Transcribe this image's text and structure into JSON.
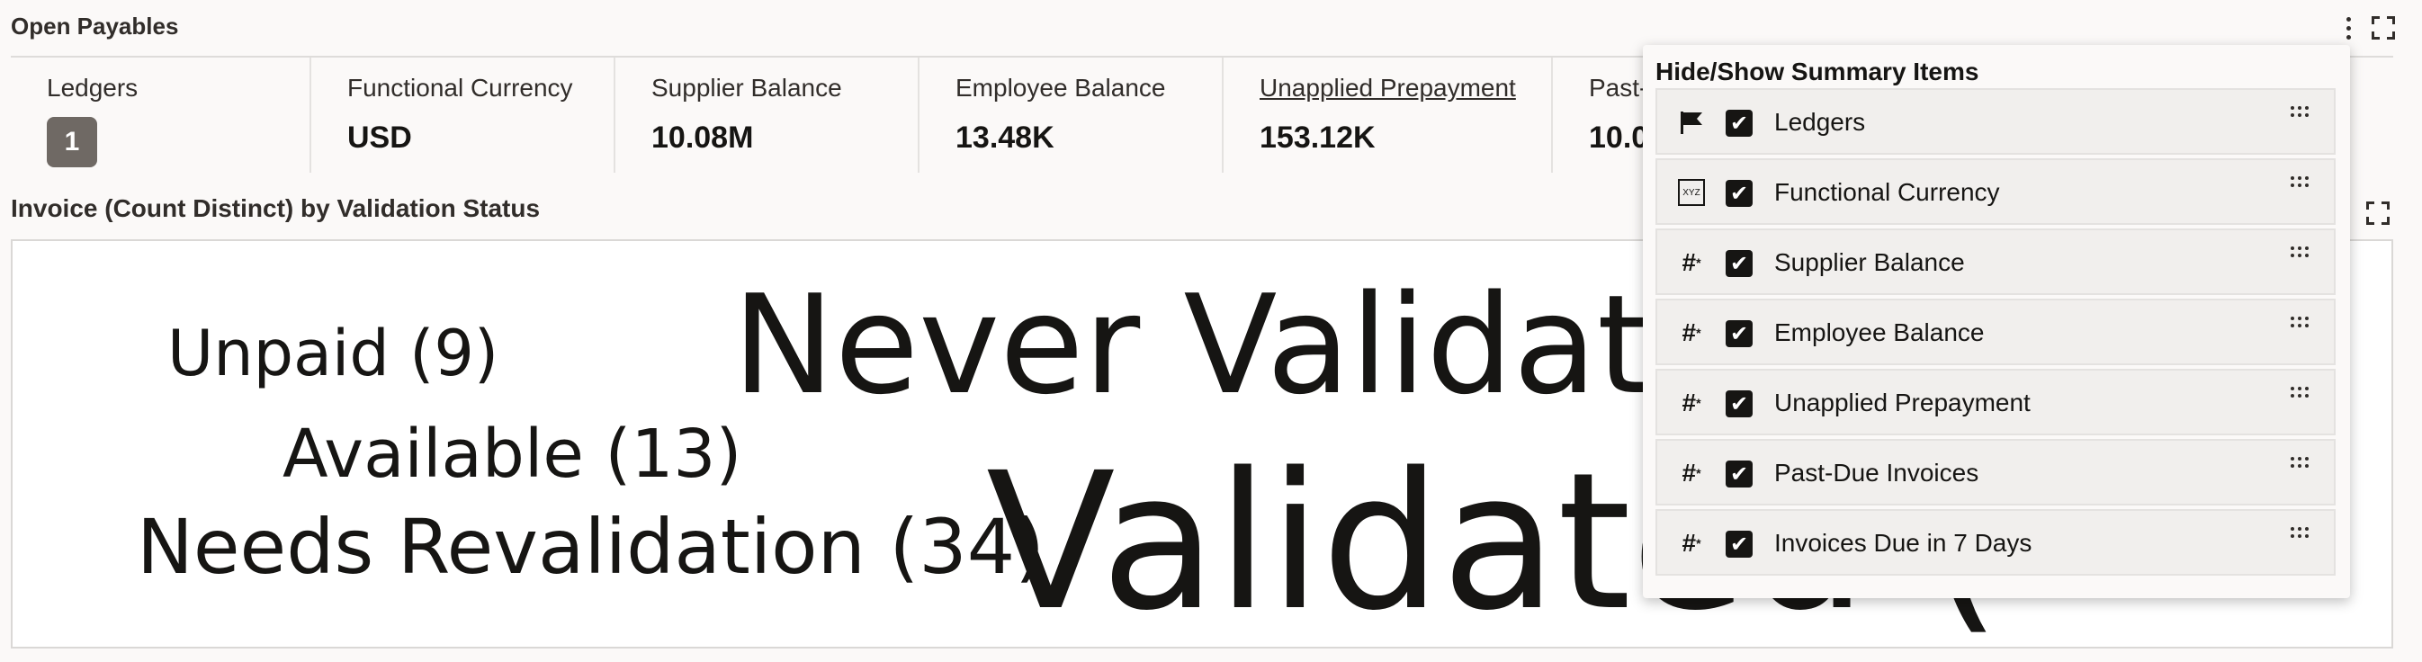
{
  "header": {
    "title": "Open Payables"
  },
  "summary": {
    "tiles": [
      {
        "label": "Ledgers",
        "value": "1"
      },
      {
        "label": "Functional Currency",
        "value": "USD"
      },
      {
        "label": "Supplier Balance",
        "value": "10.08M"
      },
      {
        "label": "Employee Balance",
        "value": "13.48K"
      },
      {
        "label": "Unapplied Prepayment",
        "value": "153.12K"
      },
      {
        "label": "Past-",
        "value": "10.0"
      }
    ]
  },
  "visual": {
    "title": "Invoice (Count Distinct) by Validation Status",
    "words": [
      {
        "text": "Never Validated",
        "count": null
      },
      {
        "text": "Unpaid (9)",
        "count": 9
      },
      {
        "text": "Available (13)",
        "count": 13
      },
      {
        "text": "Needs Revalidation (34)",
        "count": 34
      },
      {
        "text": "Validated (",
        "count": null
      }
    ]
  },
  "panel": {
    "title": "Hide/Show Summary Items",
    "items": [
      {
        "label": "Ledgers",
        "icon": "flag-icon",
        "checked": true
      },
      {
        "label": "Functional Currency",
        "icon": "text-xyz-icon",
        "checked": true
      },
      {
        "label": "Supplier Balance",
        "icon": "number-icon",
        "checked": true
      },
      {
        "label": "Employee Balance",
        "icon": "number-icon",
        "checked": true
      },
      {
        "label": "Unapplied Prepayment",
        "icon": "number-icon",
        "checked": true
      },
      {
        "label": "Past-Due Invoices",
        "icon": "number-icon",
        "checked": true
      },
      {
        "label": "Invoices Due in 7 Days",
        "icon": "number-icon",
        "checked": true
      }
    ]
  }
}
